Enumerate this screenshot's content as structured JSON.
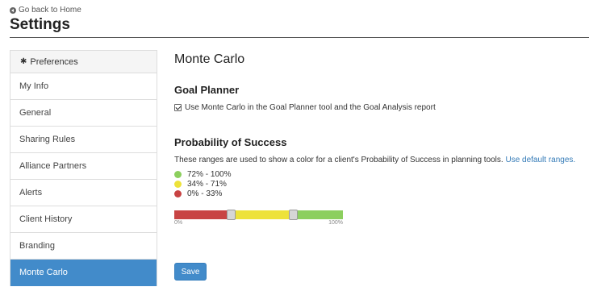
{
  "header": {
    "back_label": "Go back to Home",
    "title": "Settings"
  },
  "sidebar": {
    "heading": "Preferences",
    "items": [
      {
        "label": "My Info",
        "active": false
      },
      {
        "label": "General",
        "active": false
      },
      {
        "label": "Sharing Rules",
        "active": false
      },
      {
        "label": "Alliance Partners",
        "active": false
      },
      {
        "label": "Alerts",
        "active": false
      },
      {
        "label": "Client History",
        "active": false
      },
      {
        "label": "Branding",
        "active": false
      },
      {
        "label": "Monte Carlo",
        "active": true
      }
    ]
  },
  "main": {
    "title": "Monte Carlo",
    "goal_planner": {
      "title": "Goal Planner",
      "checkbox_label": "Use Monte Carlo in the Goal Planner tool and the Goal Analysis report",
      "checked": true
    },
    "probability": {
      "title": "Probability of Success",
      "description": "These ranges are used to show a color for a client's Probability of Success in planning tools.",
      "link_label": "Use default ranges.",
      "ranges": [
        {
          "label": "72% - 100%",
          "color": "#8ccf5e"
        },
        {
          "label": "34% - 71%",
          "color": "#ede23a"
        },
        {
          "label": "0% - 33%",
          "color": "#c84343"
        }
      ],
      "slider": {
        "min_label": "0%",
        "max_label": "100%",
        "low_threshold": 34,
        "high_threshold": 71,
        "colors": {
          "low": "#c84343",
          "mid": "#ede23a",
          "high": "#8ccf5e"
        }
      }
    },
    "save_label": "Save"
  }
}
